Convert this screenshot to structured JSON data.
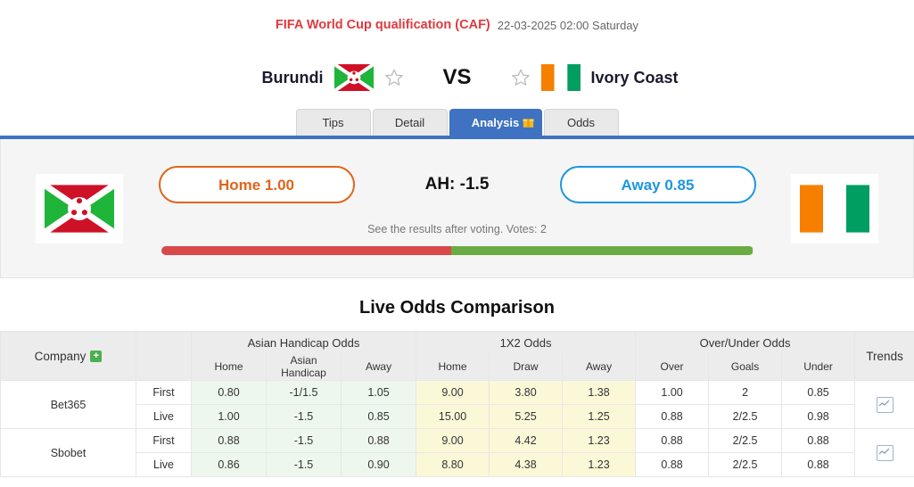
{
  "header": {
    "competition": "FIFA World Cup qualification (CAF)",
    "datetime": "22-03-2025 02:00 Saturday"
  },
  "match": {
    "home_team": "Burundi",
    "away_team": "Ivory Coast",
    "vs_label": "VS",
    "home_flag": "burundi-flag",
    "away_flag": "ivory-coast-flag",
    "home_favorite_icon": "star-outline-icon",
    "away_favorite_icon": "star-outline-icon"
  },
  "tabs": [
    {
      "label": "Tips",
      "active": false,
      "badge": null
    },
    {
      "label": "Detail",
      "active": false,
      "badge": null
    },
    {
      "label": "Analysis",
      "active": true,
      "badge": "gift-icon"
    },
    {
      "label": "Odds",
      "active": false,
      "badge": null
    }
  ],
  "vote_panel": {
    "home_button": "Home 1.00",
    "away_button": "Away 0.85",
    "handicap_label": "AH: -1.5",
    "note": "See the results after voting. Votes: 2",
    "home_percent": 49,
    "away_percent": 51,
    "home_color": "#d9494b",
    "away_color": "#6bab44"
  },
  "odds_section": {
    "title": "Live Odds Comparison",
    "company_header": "Company",
    "add_company_icon": "plus-icon",
    "groups": [
      {
        "title": "Asian Handicap Odds",
        "columns": [
          "Home",
          "Asian Handicap",
          "Away"
        ]
      },
      {
        "title": "1X2 Odds",
        "columns": [
          "Home",
          "Draw",
          "Away"
        ]
      },
      {
        "title": "Over/Under Odds",
        "columns": [
          "Over",
          "Goals",
          "Under"
        ]
      }
    ],
    "trends_header": "Trends",
    "rows": [
      {
        "company": "Bet365",
        "rowspan": 2,
        "type": "First",
        "ah": [
          "0.80",
          "-1/1.5",
          "1.05"
        ],
        "x2": [
          "9.00",
          "3.80",
          "1.38"
        ],
        "ou": [
          "1.00",
          "2",
          "0.85"
        ],
        "trend_icon": "trend-chart-icon"
      },
      {
        "company": null,
        "type": "Live",
        "ah": [
          "1.00",
          "-1.5",
          "0.85"
        ],
        "x2": [
          "15.00",
          "5.25",
          "1.25"
        ],
        "ou": [
          "0.88",
          "2/2.5",
          "0.98"
        ]
      },
      {
        "company": "Sbobet",
        "rowspan": 2,
        "type": "First",
        "ah": [
          "0.88",
          "-1.5",
          "0.88"
        ],
        "x2": [
          "9.00",
          "4.42",
          "1.23"
        ],
        "ou": [
          "0.88",
          "2/2.5",
          "0.88"
        ],
        "trend_icon": "trend-chart-icon"
      },
      {
        "company": null,
        "type": "Live",
        "ah": [
          "0.86",
          "-1.5",
          "0.90"
        ],
        "x2": [
          "8.80",
          "4.38",
          "1.23"
        ],
        "ou": [
          "0.88",
          "2/2.5",
          "0.88"
        ]
      }
    ]
  }
}
